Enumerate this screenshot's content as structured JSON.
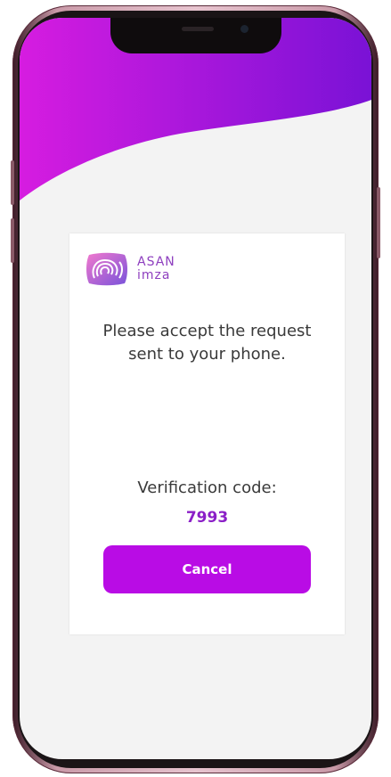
{
  "dialog": {
    "logo": {
      "line1": "ASAN",
      "line2": "imza"
    },
    "message": "Please accept the request sent to your phone.",
    "verification_label": "Verification code:",
    "verification_code": "7993",
    "cancel_label": "Cancel"
  },
  "colors": {
    "accent": "#b90ce5",
    "code_text": "#8b1fc7",
    "wave_start": "#d61ce0",
    "wave_end": "#7a12d6",
    "screen_background": "#f3f3f3"
  }
}
